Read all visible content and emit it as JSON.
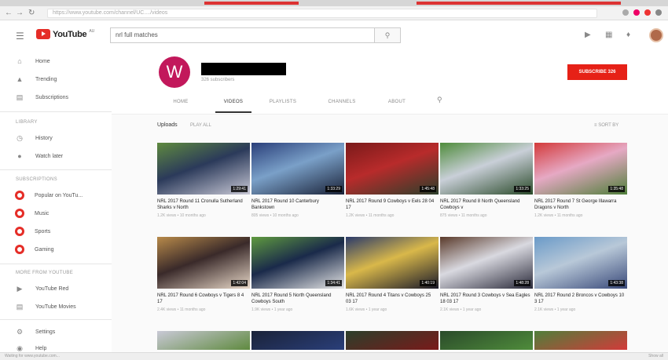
{
  "browser": {
    "url": "https://www.youtube.com/channel/UC..../videos"
  },
  "header": {
    "logo_text": "YouTube",
    "logo_sup": "AU",
    "search_value": "nrl full matches"
  },
  "sidebar": {
    "top": [
      {
        "icon": "home-icon",
        "label": "Home"
      },
      {
        "icon": "trending-icon",
        "label": "Trending"
      },
      {
        "icon": "subscriptions-icon",
        "label": "Subscriptions"
      }
    ],
    "library_heading": "LIBRARY",
    "library": [
      {
        "icon": "history-icon",
        "label": "History"
      },
      {
        "icon": "watch-later-icon",
        "label": "Watch later"
      }
    ],
    "subscriptions_heading": "SUBSCRIPTIONS",
    "subscriptions": [
      {
        "label": "Popular on YouTu..."
      },
      {
        "label": "Music"
      },
      {
        "label": "Sports"
      },
      {
        "label": "Gaming"
      }
    ],
    "more_heading": "MORE FROM YOUTUBE",
    "more": [
      {
        "icon": "youtube-red-icon",
        "label": "YouTube Red"
      },
      {
        "icon": "youtube-movies-icon",
        "label": "YouTube Movies"
      }
    ],
    "bottom": [
      {
        "icon": "settings-icon",
        "label": "Settings"
      },
      {
        "icon": "help-icon",
        "label": "Help"
      }
    ]
  },
  "channel": {
    "avatar_letter": "W",
    "subscribers": "326 subscribers",
    "subscribe_label": "SUBSCRIBE 326",
    "tabs": [
      "HOME",
      "VIDEOS",
      "PLAYLISTS",
      "CHANNELS",
      "ABOUT"
    ],
    "active_tab": "VIDEOS"
  },
  "uploads": {
    "title": "Uploads",
    "play_all": "PLAY ALL",
    "sort_by": "SORT BY"
  },
  "videos": [
    {
      "title": "NRL 2017 Round 11 Cronulla Sutherland Sharks v North",
      "meta": "1.2K views • 10 months ago",
      "duration": "1:29:41",
      "colors": [
        "#5f8a3f",
        "#2b3a5a",
        "#c9c9d6"
      ]
    },
    {
      "title": "NRL 2017 Round 10 Canterbury Bankstown",
      "meta": "805 views • 10 months ago",
      "duration": "1:33:29",
      "colors": [
        "#2a3f7a",
        "#7aa0c8",
        "#1a2238"
      ]
    },
    {
      "title": "NRL 2017 Round 9 Cowboys v Eels 28 04 17",
      "meta": "1.2K views • 11 months ago",
      "duration": "1:45:48",
      "colors": [
        "#7a1a1a",
        "#b82b2b",
        "#2b3f2b"
      ]
    },
    {
      "title": "NRL 2017 Round 8 North Queensland Cowboys v",
      "meta": "875 views • 11 months ago",
      "duration": "1:33:25",
      "colors": [
        "#4f8c3b",
        "#c9cfd8",
        "#2a4a2a"
      ]
    },
    {
      "title": "NRL 2017 Round 7 St George Illawarra Dragons v North",
      "meta": "1.2K views • 11 months ago",
      "duration": "1:35:48",
      "colors": [
        "#d33a3a",
        "#e6a9c4",
        "#4f7f3a"
      ]
    },
    {
      "title": "NRL 2017 Round 6 Cowboys v Tigers 8 4 17",
      "meta": "2.4K views • 11 months ago",
      "duration": "1:42:04",
      "colors": [
        "#b88a4a",
        "#3a2a2a",
        "#e8d8c8"
      ]
    },
    {
      "title": "NRL 2017 Round 5 North Queensland Cowboys South",
      "meta": "1.9K views • 1 year ago",
      "duration": "1:34:41",
      "colors": [
        "#5f9a3f",
        "#1a2a4a",
        "#e6e6e6"
      ]
    },
    {
      "title": "NRL 2017 Round 4 Titans v Cowboys 25 03 17",
      "meta": "1.6K views • 1 year ago",
      "duration": "1:40:19",
      "colors": [
        "#2a3a6a",
        "#d9b84a",
        "#1a1a2a"
      ]
    },
    {
      "title": "NRL 2017 Round 3 Cowboys v Sea Eagles 18 03 17",
      "meta": "2.1K views • 1 year ago",
      "duration": "1:48:28",
      "colors": [
        "#5a3a2a",
        "#d9d9e0",
        "#2a2a3a"
      ]
    },
    {
      "title": "NRL 2017 Round 2 Broncos v Cowboys 10 3 17",
      "meta": "2.1K views • 1 year ago",
      "duration": "1:43:38",
      "colors": [
        "#6a9ac8",
        "#b8c8d8",
        "#3a4a7a"
      ]
    }
  ],
  "status_bar": {
    "left": "Waiting for www.youtube.com...",
    "right": "Show all"
  }
}
